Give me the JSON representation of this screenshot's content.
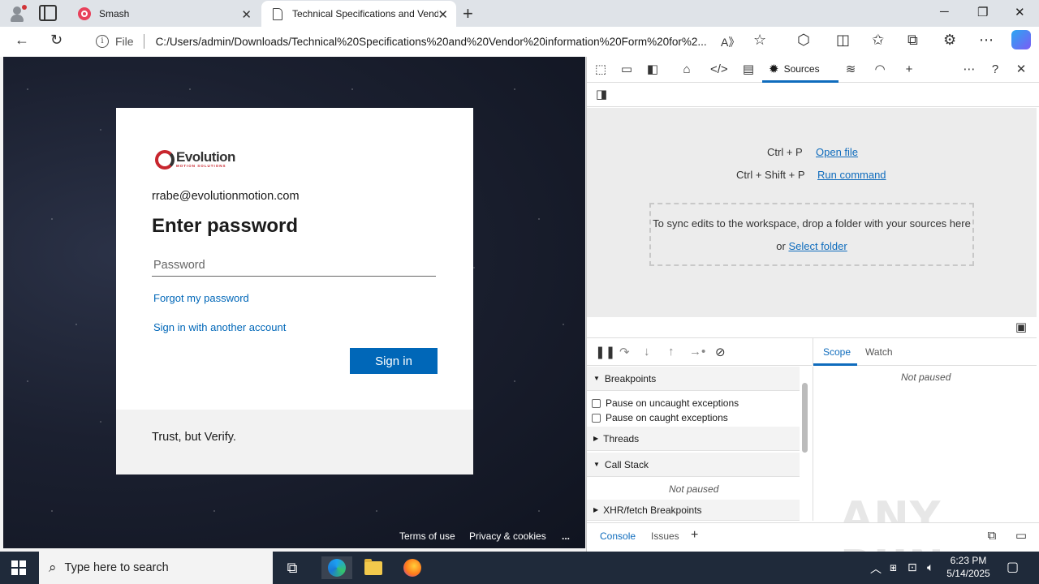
{
  "browser": {
    "tabs": [
      {
        "title": "Smash",
        "close": "✕"
      },
      {
        "title": "Technical Specifications and Vendor",
        "close": "✕"
      }
    ],
    "new_tab": "+",
    "window": {
      "minimize": "─",
      "restore": "❐",
      "close": "✕"
    },
    "address": {
      "info": "i",
      "file_label": "File",
      "url": "C:/Users/admin/Downloads/Technical%20Specifications%20and%20Vendor%20information%20Form%20for%2..."
    }
  },
  "login": {
    "logo_word": "Evolution",
    "logo_sub": "MOTION SOLUTIONS",
    "email": "rrabe@evolutionmotion.com",
    "heading": "Enter password",
    "password_placeholder": "Password",
    "forgot_link": "Forgot my password",
    "other_account_link": "Sign in with another account",
    "signin_button": "Sign in",
    "footer_text": "Trust, but Verify.",
    "terms": "Terms of use",
    "privacy": "Privacy & cookies",
    "more": "..."
  },
  "devtools": {
    "active_tab": "Sources",
    "shortcuts": [
      {
        "keys": "Ctrl + P",
        "action": "Open file"
      },
      {
        "keys": "Ctrl + Shift + P",
        "action": "Run command"
      }
    ],
    "dropzone_text": "To sync edits to the workspace, drop a folder with your sources here or",
    "dropzone_link": "Select folder",
    "sections": {
      "breakpoints": "Breakpoints",
      "pause_uncaught": "Pause on uncaught exceptions",
      "pause_caught": "Pause on caught exceptions",
      "threads": "Threads",
      "call_stack": "Call Stack",
      "not_paused": "Not paused",
      "xhr": "XHR/fetch Breakpoints"
    },
    "scope_tabs": [
      "Scope",
      "Watch"
    ],
    "scope_not_paused": "Not paused",
    "drawer_tabs": [
      "Console",
      "Issues"
    ],
    "drawer_add": "+"
  },
  "watermark": "ANY RUN",
  "taskbar": {
    "search_placeholder": "Type here to search",
    "time": "6:23 PM",
    "date": "5/14/2025"
  }
}
